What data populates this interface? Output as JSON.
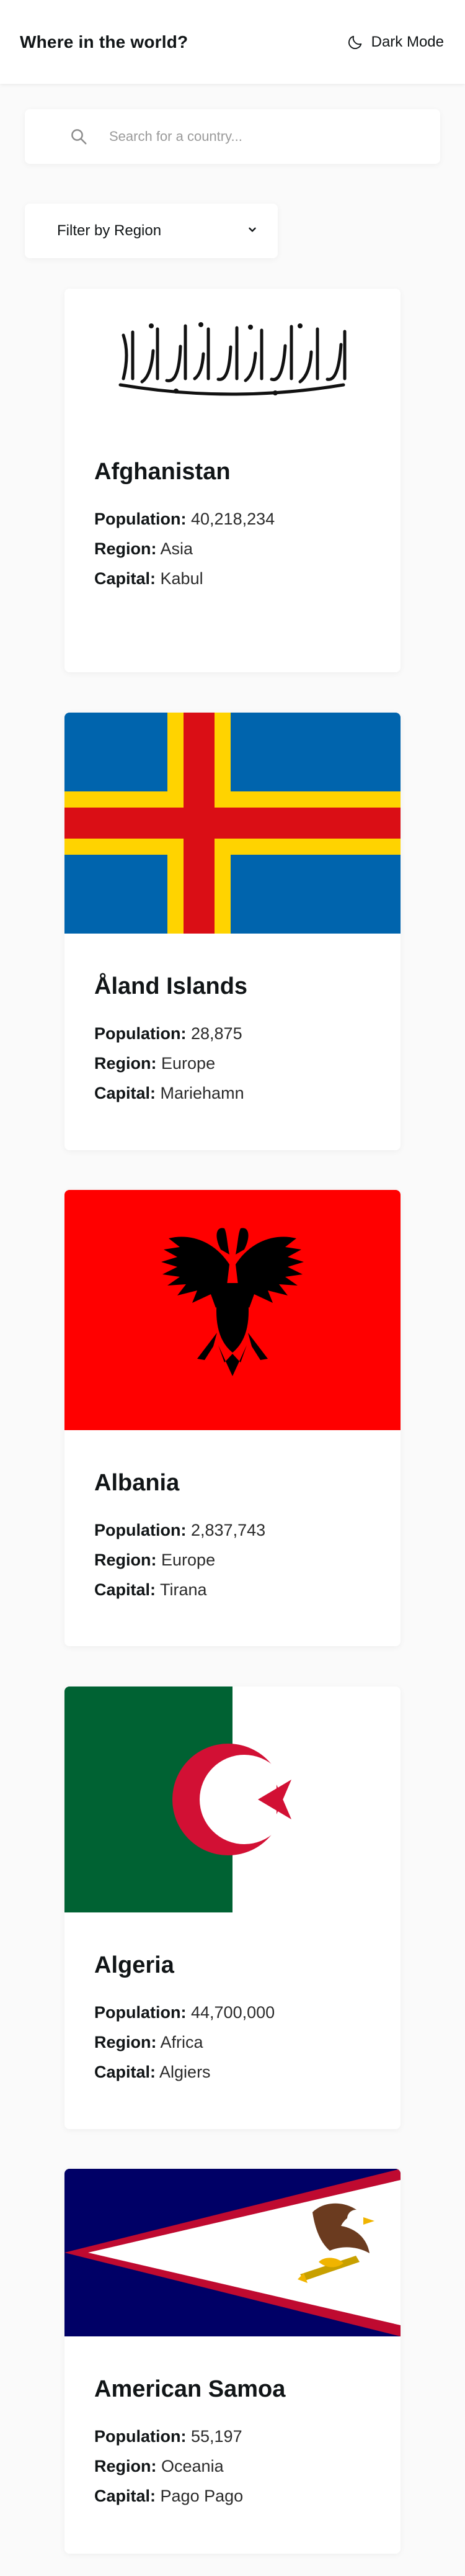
{
  "header": {
    "title": "Where in the world?",
    "mode_toggle_label": "Dark Mode",
    "mode_icon": "moon-icon"
  },
  "search": {
    "icon": "search-icon",
    "placeholder": "Search for a country...",
    "value": ""
  },
  "filter": {
    "label": "Filter by Region",
    "icon": "chevron-down-icon"
  },
  "labels": {
    "population": "Population:",
    "region": "Region:",
    "capital": "Capital:"
  },
  "countries": [
    {
      "name": "Afghanistan",
      "population": "40,218,234",
      "region": "Asia",
      "capital": "Kabul",
      "flag_icon": "afghanistan-flag-icon"
    },
    {
      "name": "Åland Islands",
      "population": "28,875",
      "region": "Europe",
      "capital": "Mariehamn",
      "flag_icon": "aland-islands-flag-icon"
    },
    {
      "name": "Albania",
      "population": "2,837,743",
      "region": "Europe",
      "capital": "Tirana",
      "flag_icon": "albania-flag-icon"
    },
    {
      "name": "Algeria",
      "population": "44,700,000",
      "region": "Africa",
      "capital": "Algiers",
      "flag_icon": "algeria-flag-icon"
    },
    {
      "name": "American Samoa",
      "population": "55,197",
      "region": "Oceania",
      "capital": "Pago Pago",
      "flag_icon": "american-samoa-flag-icon"
    }
  ],
  "colors": {
    "background": "#fafafa",
    "element": "#ffffff",
    "text": "#111517",
    "aland_blue": "#0064ad",
    "aland_yellow": "#ffd300",
    "aland_red": "#da0e15",
    "albania_red": "#ff0000",
    "algeria_green": "#006233",
    "algeria_red": "#d21034",
    "samoa_navy": "#000066",
    "samoa_red": "#bf0a30"
  }
}
